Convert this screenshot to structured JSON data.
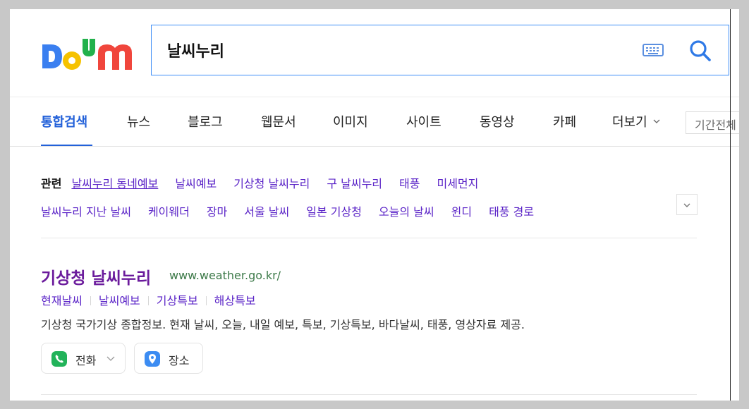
{
  "header": {
    "logo_text": "Daum",
    "search_value": "날씨누리",
    "keyboard_icon": "keyboard-icon",
    "search_icon": "search-icon",
    "brand_colors": {
      "blue": "#3a7ff0",
      "yellow": "#f6c200",
      "green": "#21b14b",
      "red": "#f0463c",
      "purple": "#8a4bd8"
    }
  },
  "tabs": {
    "items": [
      {
        "label": "통합검색",
        "active": true
      },
      {
        "label": "뉴스"
      },
      {
        "label": "블로그"
      },
      {
        "label": "웹문서"
      },
      {
        "label": "이미지"
      },
      {
        "label": "사이트"
      },
      {
        "label": "동영상"
      },
      {
        "label": "카페"
      },
      {
        "label": "더보기"
      }
    ],
    "period_label": "기간전체",
    "accent_color": "#2361d9"
  },
  "related": {
    "label": "관련",
    "links": [
      "날씨누리 동네예보",
      "날씨예보",
      "기상청 날씨누리",
      "구 날씨누리",
      "태풍",
      "미세먼지",
      "날씨누리 지난 날씨",
      "케이웨더",
      "장마",
      "서울 날씨",
      "일본 기상청",
      "오늘의 날씨",
      "윈디",
      "태풍 경로"
    ]
  },
  "result": {
    "title": "기상청 날씨누리",
    "url": "www.weather.go.kr/",
    "sublinks": [
      "현재날씨",
      "날씨예보",
      "기상특보",
      "해상특보"
    ],
    "description": "기상청 국가기상 종합정보. 현재 날씨, 오늘, 내일 예보, 특보, 기상특보, 바다날씨, 태풍, 영상자료 제공.",
    "buttons": {
      "call": "전화",
      "place": "장소"
    }
  }
}
